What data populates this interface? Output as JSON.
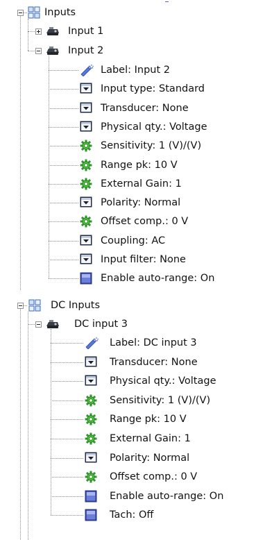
{
  "groups": [
    {
      "label": "Inputs",
      "icon": "group-grid-icon",
      "children": [
        {
          "label": "Input 1",
          "icon": "channel-icon",
          "collapsed": true,
          "properties": []
        },
        {
          "label": "Input 2",
          "icon": "channel-icon",
          "collapsed": false,
          "properties": [
            {
              "text": "Label: Input 2",
              "icon": "label-edit-icon"
            },
            {
              "text": "Input type: Standard",
              "icon": "dropdown-icon"
            },
            {
              "text": "Transducer: None",
              "icon": "dropdown-icon"
            },
            {
              "text": "Physical qty.: Voltage",
              "icon": "dropdown-icon"
            },
            {
              "text": "Sensitivity: 1 (V)/(V)",
              "icon": "value-gear-icon"
            },
            {
              "text": "Range pk: 10 V",
              "icon": "value-gear-icon"
            },
            {
              "text": "External Gain: 1",
              "icon": "value-gear-icon"
            },
            {
              "text": "Polarity: Normal",
              "icon": "dropdown-icon"
            },
            {
              "text": "Offset comp.: 0 V",
              "icon": "value-gear-icon"
            },
            {
              "text": "Coupling: AC",
              "icon": "dropdown-icon"
            },
            {
              "text": "Input filter: None",
              "icon": "dropdown-icon"
            },
            {
              "text": "Enable auto-range: On",
              "icon": "toggle-icon"
            }
          ]
        }
      ]
    },
    {
      "label": "DC Inputs",
      "icon": "group-grid-icon",
      "children": [
        {
          "label": "DC input 3",
          "icon": "channel-icon",
          "collapsed": false,
          "properties": [
            {
              "text": "Label: DC input 3",
              "icon": "label-edit-icon"
            },
            {
              "text": "Transducer: None",
              "icon": "dropdown-icon"
            },
            {
              "text": "Physical qty.: Voltage",
              "icon": "dropdown-icon"
            },
            {
              "text": "Sensitivity: 1 (V)/(V)",
              "icon": "value-gear-icon"
            },
            {
              "text": "Range pk: 10 V",
              "icon": "value-gear-icon"
            },
            {
              "text": "External Gain: 1",
              "icon": "value-gear-icon"
            },
            {
              "text": "Polarity: Normal",
              "icon": "dropdown-icon"
            },
            {
              "text": "Offset comp.: 0 V",
              "icon": "value-gear-icon"
            },
            {
              "text": "Enable auto-range: On",
              "icon": "toggle-icon"
            },
            {
              "text": "Tach: Off",
              "icon": "toggle-icon"
            }
          ]
        }
      ]
    }
  ]
}
